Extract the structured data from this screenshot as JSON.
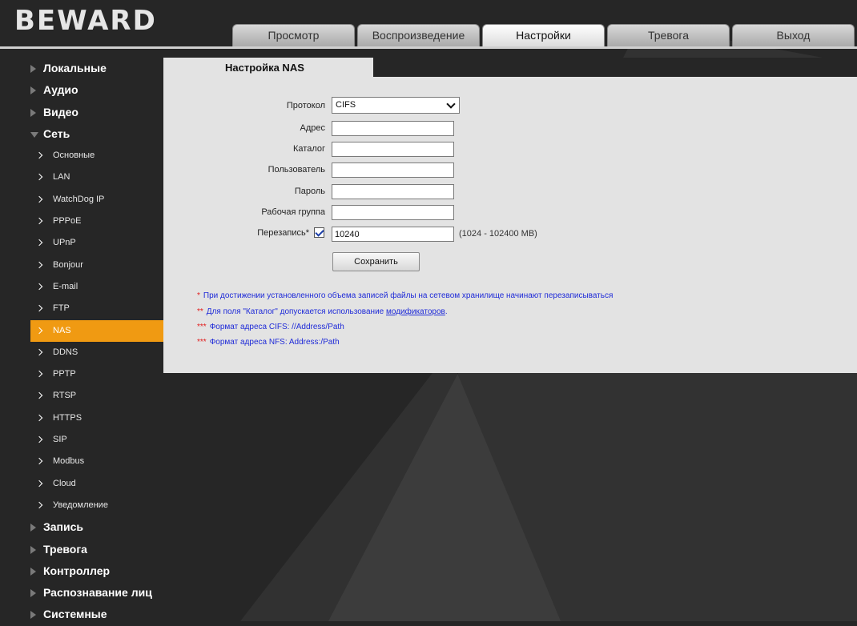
{
  "brand": {
    "logo_text": "BEWARD"
  },
  "nav": {
    "tabs": [
      {
        "label": "Просмотр"
      },
      {
        "label": "Воспроизведение"
      },
      {
        "label": "Настройки",
        "active": true
      },
      {
        "label": "Тревога"
      },
      {
        "label": "Выход"
      }
    ]
  },
  "sidebar": {
    "items": [
      {
        "label": "Локальные",
        "level": "top"
      },
      {
        "label": "Аудио",
        "level": "top"
      },
      {
        "label": "Видео",
        "level": "top"
      },
      {
        "label": "Сеть",
        "level": "top",
        "expanded": true
      },
      {
        "label": "Основные",
        "level": "sub"
      },
      {
        "label": "LAN",
        "level": "sub"
      },
      {
        "label": "WatchDog IP",
        "level": "sub"
      },
      {
        "label": "PPPoE",
        "level": "sub"
      },
      {
        "label": "UPnP",
        "level": "sub"
      },
      {
        "label": "Bonjour",
        "level": "sub"
      },
      {
        "label": "E-mail",
        "level": "sub"
      },
      {
        "label": "FTP",
        "level": "sub"
      },
      {
        "label": "NAS",
        "level": "sub",
        "active": true
      },
      {
        "label": "DDNS",
        "level": "sub"
      },
      {
        "label": "PPTP",
        "level": "sub"
      },
      {
        "label": "RTSP",
        "level": "sub"
      },
      {
        "label": "HTTPS",
        "level": "sub"
      },
      {
        "label": "SIP",
        "level": "sub"
      },
      {
        "label": "Modbus",
        "level": "sub"
      },
      {
        "label": "Cloud",
        "level": "sub"
      },
      {
        "label": "Уведомление",
        "level": "sub"
      },
      {
        "label": "Запись",
        "level": "top"
      },
      {
        "label": "Тревога",
        "level": "top"
      },
      {
        "label": "Контроллер",
        "level": "top"
      },
      {
        "label": "Распознавание лиц",
        "level": "top"
      },
      {
        "label": "Системные",
        "level": "top"
      }
    ]
  },
  "panel": {
    "title": "Настройка NAS",
    "form": {
      "protocol": {
        "label": "Протокол",
        "value": "CIFS"
      },
      "address": {
        "label": "Адрес",
        "value": ""
      },
      "directory": {
        "label": "Каталог",
        "value": ""
      },
      "user": {
        "label": "Пользователь",
        "value": ""
      },
      "password": {
        "label": "Пароль",
        "value": ""
      },
      "workgroup": {
        "label": "Рабочая группа",
        "value": ""
      },
      "overwrite": {
        "label": "Перезапись*",
        "checked": true,
        "value": "10240",
        "range": "(1024 - 102400 MB)"
      },
      "save_label": "Сохранить"
    },
    "notes": {
      "n1": {
        "marker": "*",
        "text": "При достижении установленного объема записей файлы на сетевом хранилище начинают перезаписываться"
      },
      "n2": {
        "marker": "**",
        "text": "Для поля \"Каталог\" допускается использование ",
        "link": "модификаторов",
        "tail": "."
      },
      "n3": {
        "marker": "***",
        "text": "Формат адреса CIFS: //Address/Path"
      },
      "n4": {
        "marker": "***",
        "text": "Формат адреса NFS: Address:/Path"
      }
    }
  },
  "colors": {
    "background": "#262626",
    "panel": "#e3e3e3",
    "accent": "#f09a12",
    "note_text": "#1f2bd8",
    "note_marker": "#e21b1b"
  }
}
